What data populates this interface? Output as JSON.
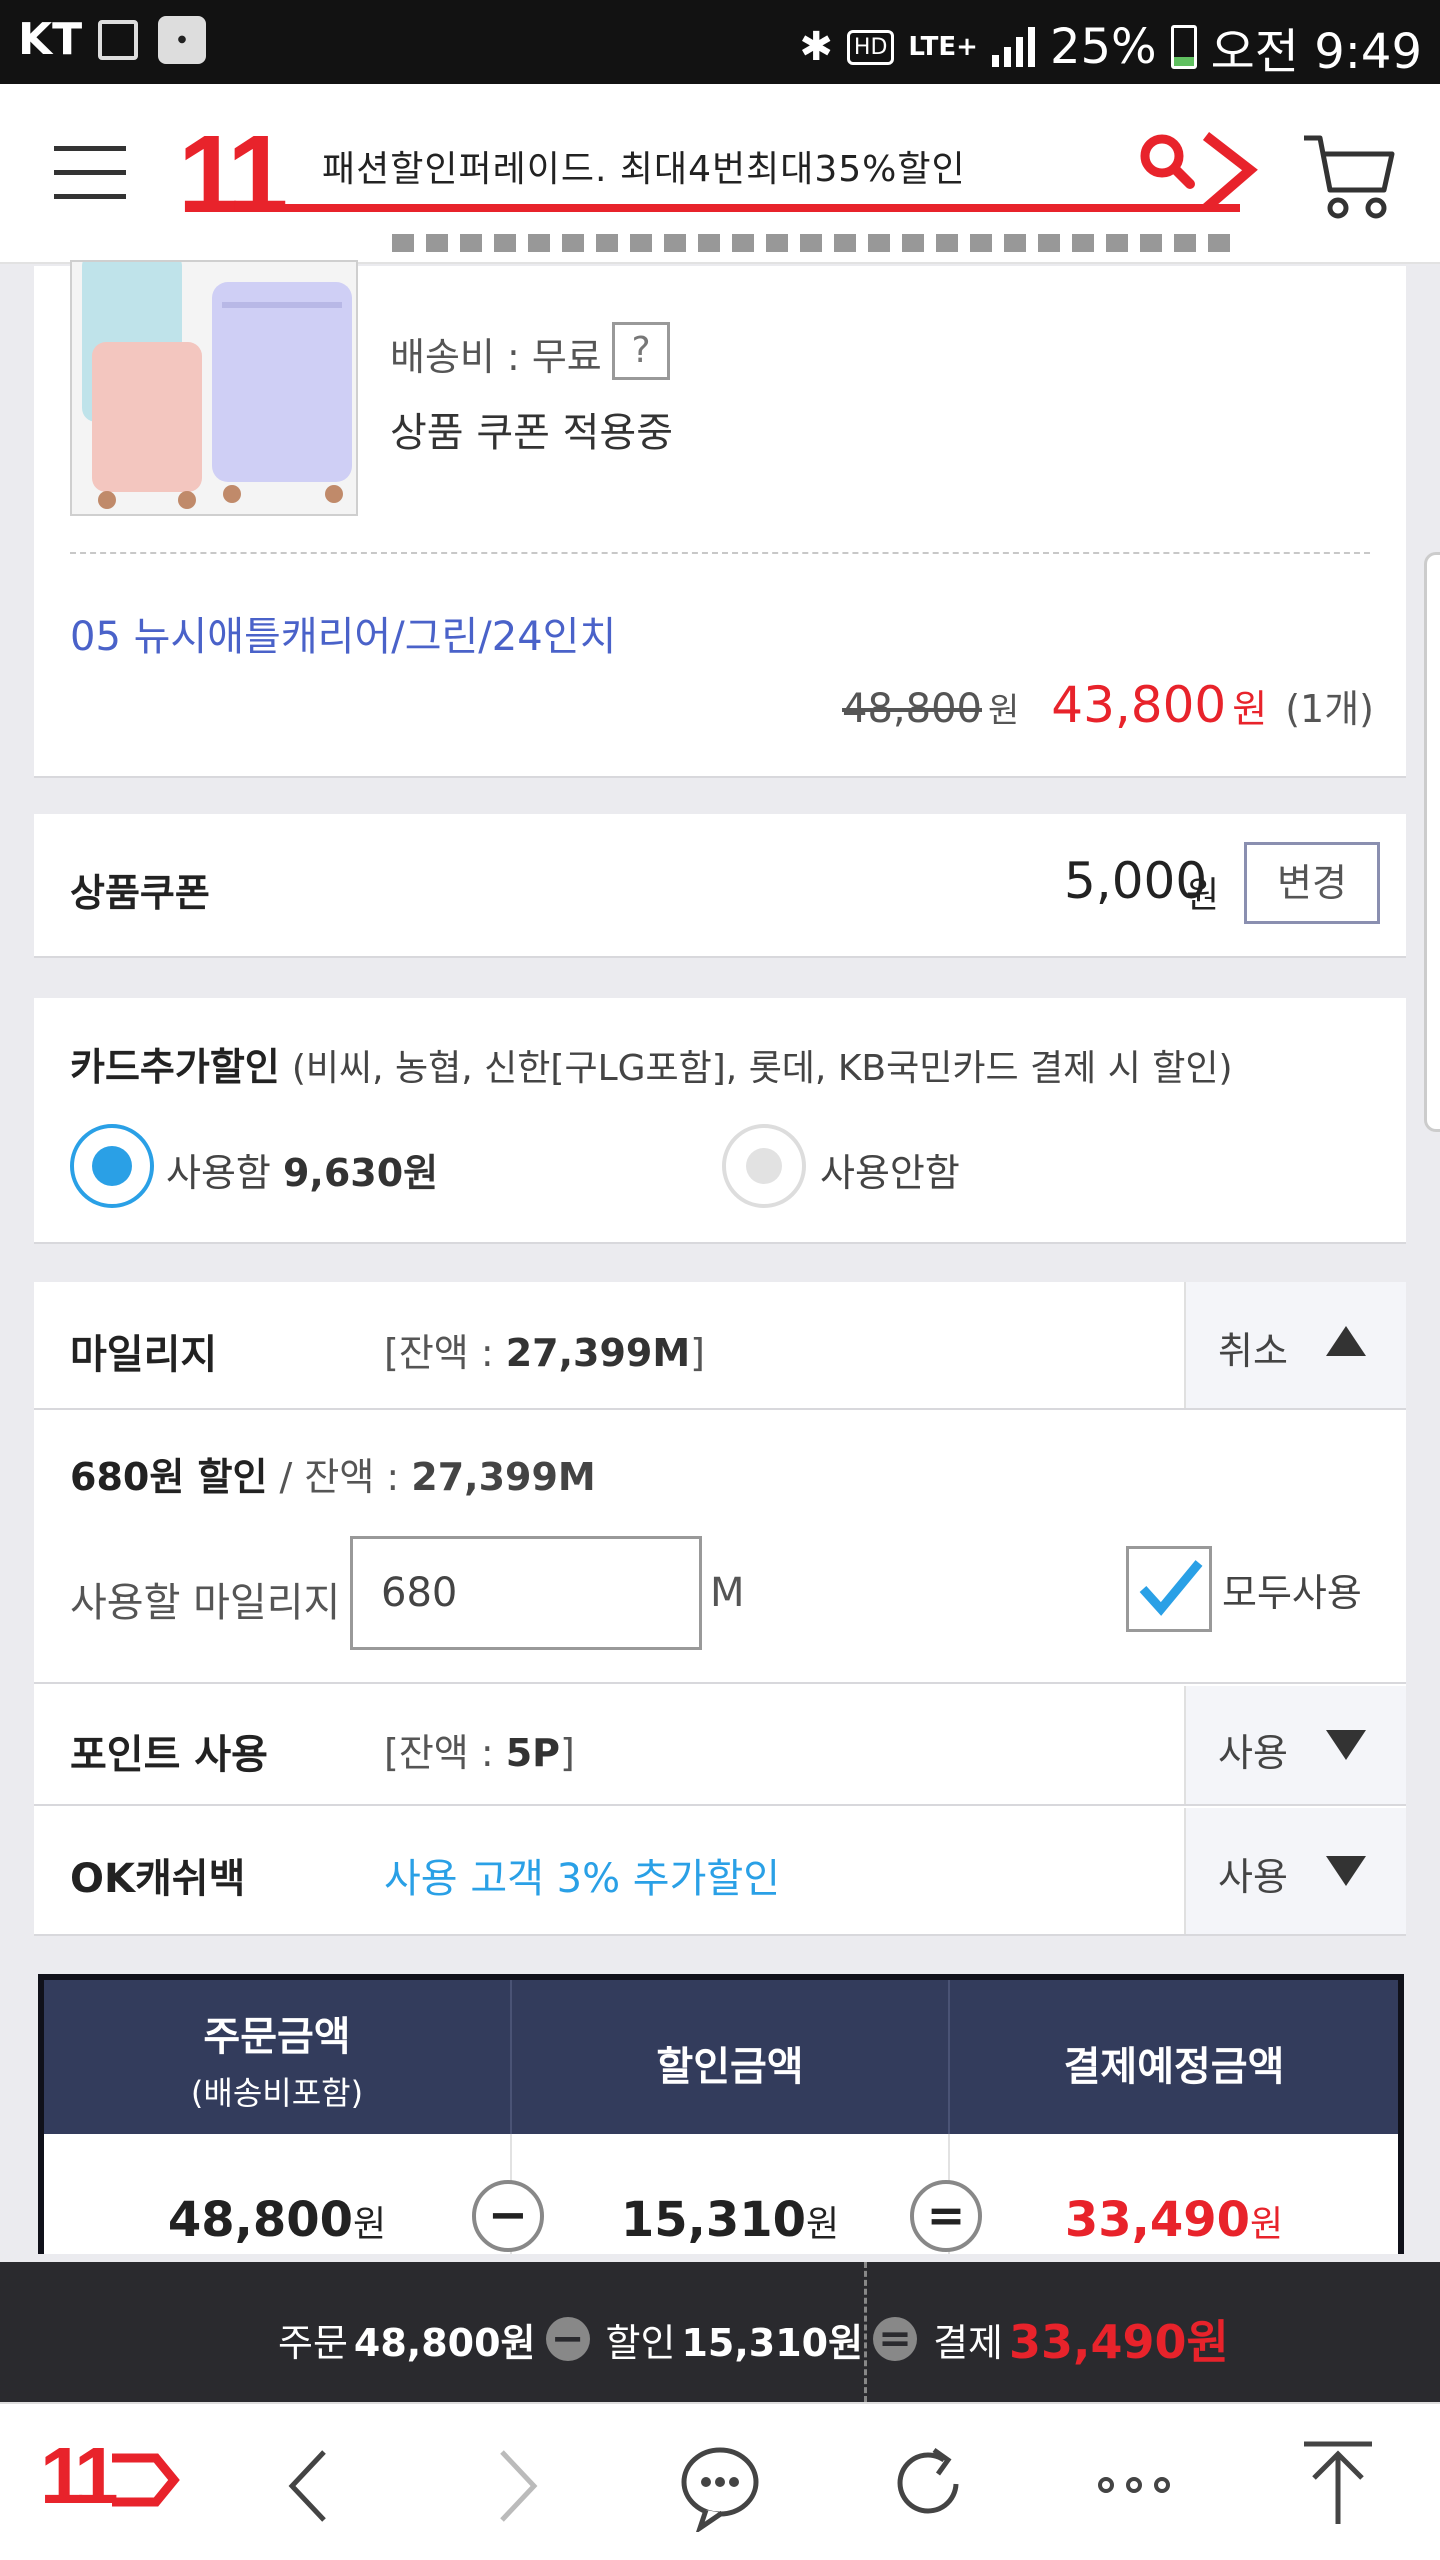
{
  "status_bar": {
    "carrier": "KT",
    "hd": "HD",
    "lte": "LTE+",
    "battery": "25%",
    "time": "오전 9:49",
    "battery_level": 0.25
  },
  "header": {
    "logo": "11",
    "search_text": "패션할인퍼레이드. 최대4번최대35%할인"
  },
  "product": {
    "shipping_label": "배송비 : 무료",
    "shipping_help": "?",
    "coupon_applied": "상품 쿠폰 적용중",
    "option_name": "05 뉴시애틀캐리어/그린/24인치",
    "original_price": "48,800",
    "original_price_unit": "원",
    "sale_price": "43,800",
    "sale_price_unit": "원",
    "quantity": "(1개)"
  },
  "coupon": {
    "label": "상품쿠폰",
    "amount": "5,000",
    "unit": "원",
    "change_button": "변경"
  },
  "card_discount": {
    "label": "카드추가할인",
    "desc": "(비씨, 농협, 신한[구LG포함], 롯데, KB국민카드 결제 시 할인)",
    "use_label": "사용함",
    "use_amount": "9,630원",
    "no_use_label": "사용안함"
  },
  "mileage": {
    "label": "마일리지",
    "balance_prefix": "[잔액 : ",
    "balance": "27,399M",
    "balance_suffix": "]",
    "cancel": "취소",
    "discount": "680원 할인",
    "discount_balance_label": " / 잔액 : ",
    "discount_balance": "27,399M",
    "use_label": "사용할 마일리지",
    "input_value": "680",
    "input_unit": "M",
    "use_all": "모두사용"
  },
  "points": {
    "label": "포인트 사용",
    "balance_prefix": "[잔액 : ",
    "balance": "5P",
    "balance_suffix": "]",
    "action": "사용"
  },
  "okcashbag": {
    "label": "OK캐쉬백",
    "promo": "사용 고객 3% 추가할인",
    "action": "사용"
  },
  "summary": {
    "order_label": "주문금액",
    "order_sub": "(배송비포함)",
    "discount_label": "할인금액",
    "pay_label": "결제예정금액",
    "order_amount": "48,800",
    "discount_amount": "15,310",
    "pay_amount": "33,490",
    "unit": "원",
    "minus": "−",
    "equals": "="
  },
  "bottom_bar": {
    "order_prefix": "주문",
    "order_amount": "48,800원",
    "discount_prefix": "할인",
    "discount_amount": "15,310원",
    "pay_prefix": "결제",
    "pay_amount": "33,490원",
    "minus": "−",
    "equals": "="
  },
  "nav": {
    "home_logo": "11"
  },
  "colors": {
    "brand_red": "#e8232b",
    "link_blue": "#4a62c9",
    "sky": "#2aa0e6",
    "navy": "#333c5c"
  }
}
